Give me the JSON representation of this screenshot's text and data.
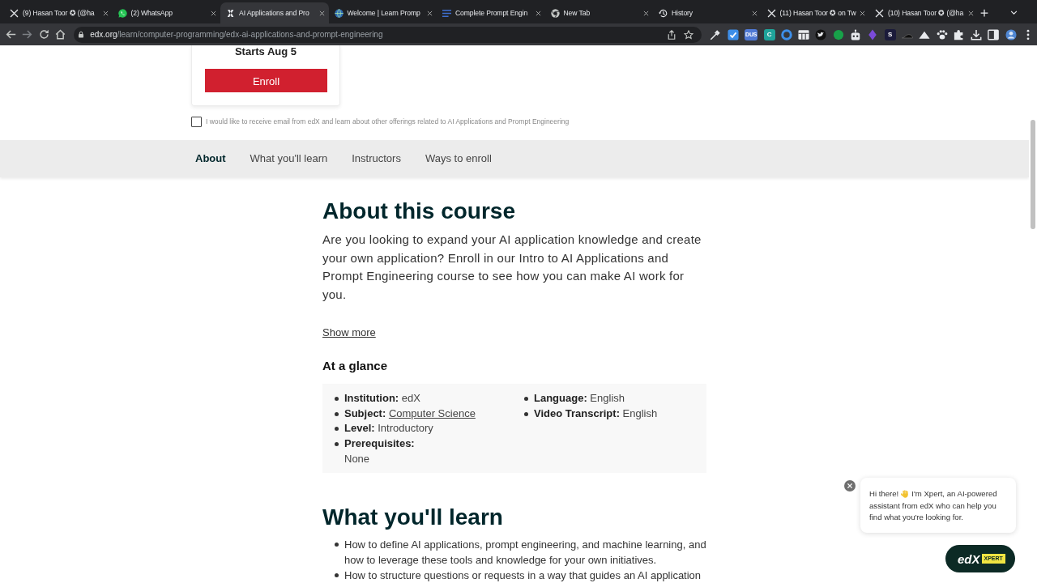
{
  "browser": {
    "tabs": [
      {
        "kind": "cross",
        "title": "(9) Hasan Toor ✪ (@ha",
        "selected": false
      },
      {
        "kind": "chat",
        "title": "(2) WhatsApp",
        "selected": false
      },
      {
        "kind": "slanted",
        "title": "AI Applications and Pro",
        "selected": true
      },
      {
        "kind": "globe",
        "title": "Welcome | Learn Promp",
        "selected": false
      },
      {
        "kind": "lines",
        "title": "Complete Prompt Engin",
        "selected": false
      },
      {
        "kind": "aperture",
        "title": "New Tab",
        "selected": false
      },
      {
        "kind": "clock",
        "title": "History",
        "selected": false
      },
      {
        "kind": "cross",
        "title": "(11) Hasan Toor ✪ on Tw",
        "selected": false
      },
      {
        "kind": "cross",
        "title": "(10) Hasan Toor ✪ (@ha",
        "selected": false
      }
    ],
    "address": {
      "host": "edx.org",
      "path": "/learn/computer-programming/edx-ai-applications-and-prompt-engineering"
    },
    "extensions": [
      {
        "kind": "eyedropper"
      },
      {
        "kind": "tile"
      },
      {
        "kind": "label",
        "label": "DUS",
        "color": "#4f79d4"
      },
      {
        "kind": "label",
        "label": "C",
        "color": "#1fa39a"
      },
      {
        "kind": "ring"
      },
      {
        "kind": "grid"
      },
      {
        "kind": "bird"
      },
      {
        "kind": "dot"
      },
      {
        "kind": "robot"
      },
      {
        "kind": "diamond"
      },
      {
        "kind": "label",
        "label": "S",
        "color": "#1b1b3a"
      },
      {
        "kind": "wedge"
      },
      {
        "kind": "mountain"
      },
      {
        "kind": "paw"
      },
      {
        "kind": "puzzle"
      },
      {
        "kind": "download"
      },
      {
        "kind": "sidebar"
      },
      {
        "kind": "avatar"
      },
      {
        "kind": "menu"
      }
    ]
  },
  "enroll_card": {
    "start_date": "Starts Aug 5",
    "button": "Enroll"
  },
  "email_opt_in": {
    "label": "I would like to receive email from edX and learn about other offerings related to AI Applications and Prompt Engineering",
    "checked": false
  },
  "section_nav": [
    {
      "label": "About",
      "selected": true
    },
    {
      "label": "What you'll learn",
      "selected": false
    },
    {
      "label": "Instructors",
      "selected": false
    },
    {
      "label": "Ways to enroll",
      "selected": false
    }
  ],
  "about": {
    "title": "About this course",
    "description": "Are you looking to expand your AI application knowledge and create your own application? Enroll in our Intro to AI Applications and Prompt Engineering course to see how you can make AI work for you.",
    "show_more": "Show more"
  },
  "at_a_glance": {
    "title": "At a glance",
    "columns": [
      [
        {
          "kind": "text",
          "label": "Institution:",
          "value": "edX"
        },
        {
          "kind": "link",
          "label": "Subject:",
          "value": "Computer Science"
        },
        {
          "kind": "text",
          "label": "Level:",
          "value": "Introductory"
        },
        {
          "kind": "block",
          "label": "Prerequisites:",
          "value": "None"
        }
      ],
      [
        {
          "kind": "text",
          "label": "Language:",
          "value": "English"
        },
        {
          "kind": "text",
          "label": "Video Transcript:",
          "value": "English"
        }
      ]
    ]
  },
  "what_youll_learn": {
    "title": "What you'll learn",
    "items": [
      "How to define AI applications, prompt engineering, and machine learning, and how to leverage these tools and knowledge for your own initiatives.",
      "How to structure questions or requests in a way that guides an AI application"
    ]
  },
  "chat": {
    "greeting": "Hi there!",
    "message": [
      "I'm Xpert, an AI-powered",
      "assistant from edX who can help you find what you're looking for."
    ],
    "launcher": {
      "logo": "edX",
      "tag": "XPERT"
    }
  }
}
